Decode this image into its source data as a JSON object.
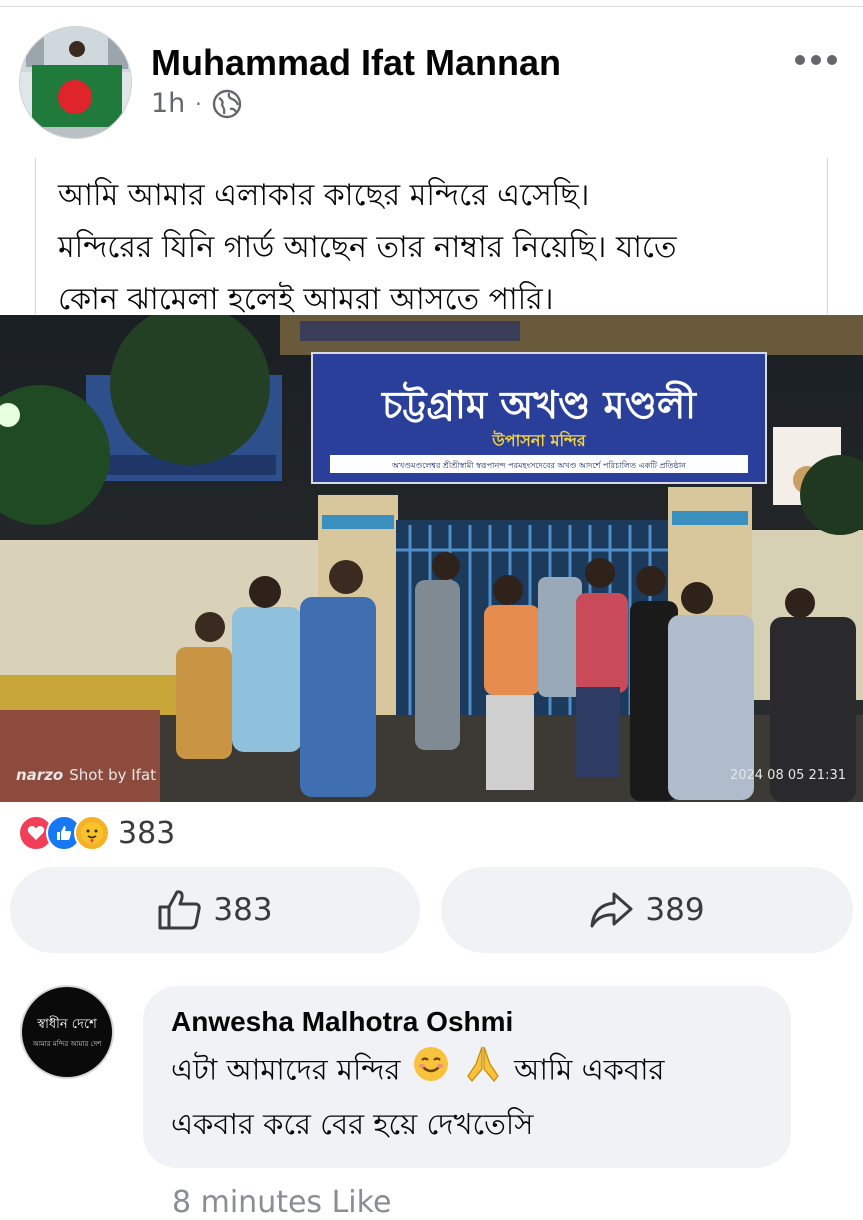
{
  "post": {
    "author": "Muhammad Ifat Mannan",
    "time": "1h",
    "separator": "·",
    "privacy_icon": "globe-icon",
    "more_icon": "more-options-icon",
    "text_lines": [
      "আমি আমার এলাকার কাছের মন্দিরে এসেছি।",
      "মন্দিরের যিনি গার্ড আছেন তার নাম্বার নিয়েছি। যাতে",
      "কোন ঝামেলা হলেই আমরা আসতে পারি।"
    ]
  },
  "photo": {
    "sign_main": "চট্টগ্রাম অখণ্ড মণ্ডলী",
    "sign_sub": "উপাসনা মন্দির",
    "sign_bottom": "অখণ্ডমণ্ডলেশ্বর শ্রীশ্রীস্বামী স্বরূপানন্দ পরমহংসদেবের অখণ্ড আদর্শে পরিচালিত একটি প্রতিষ্ঠান",
    "watermark_brand": "narzo",
    "watermark_text": "Shot by Ifat",
    "timestamp": "2024 08 05 21:31"
  },
  "reactions": {
    "icons": [
      "love-reaction-icon",
      "like-reaction-icon",
      "care-reaction-icon"
    ],
    "count": "383"
  },
  "actions": {
    "like_count": "383",
    "share_count": "389"
  },
  "comment": {
    "avatar_line1": "স্বাধীন দেশে",
    "avatar_line2": "আমার মন্দির আমার দেশ",
    "author": "Anwesha Malhotra Oshmi",
    "line1_a": "এটা আমাদের মন্দির",
    "line1_b": "আমি একবার",
    "line2": "একবার করে বের হয়ে দেখতেসি"
  },
  "next_partial": "8 minutes Like"
}
